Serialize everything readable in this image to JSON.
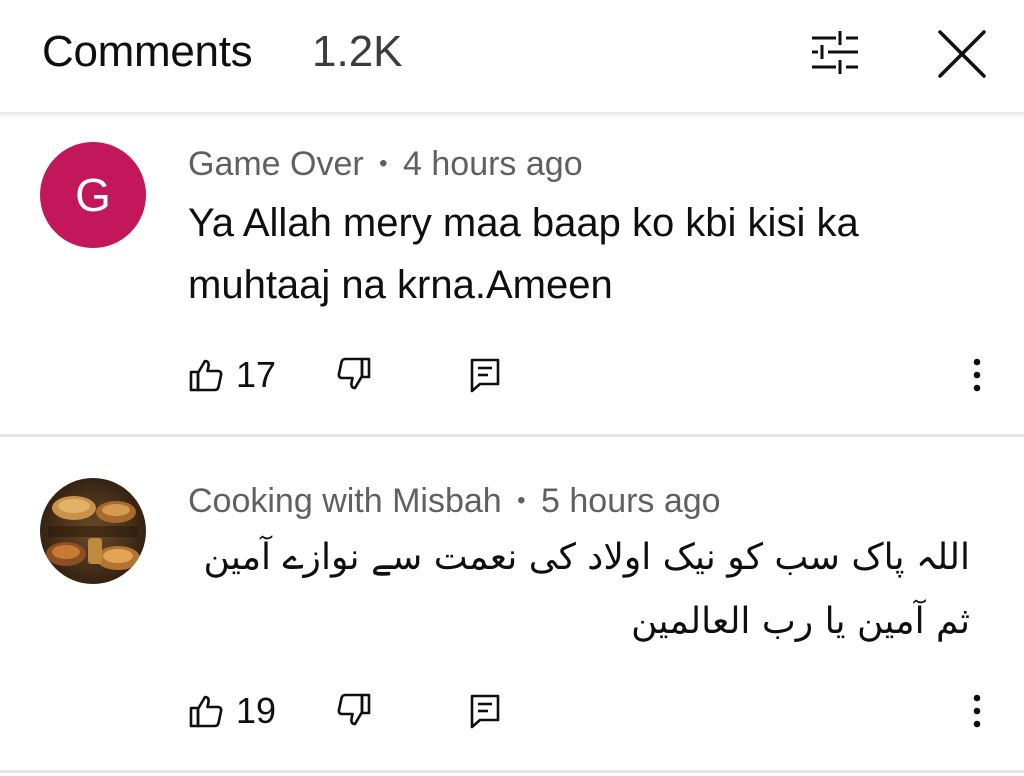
{
  "header": {
    "title": "Comments",
    "count": "1.2K",
    "filter_icon": "sliders-icon",
    "close_icon": "close-icon"
  },
  "comments": [
    {
      "avatar_letter": "G",
      "avatar_color": "#c2185b",
      "author": "Game Over",
      "separator": "•",
      "time": "4 hours ago",
      "text": "Ya Allah mery maa baap ko kbi kisi ka muhtaaj na krna.Ameen",
      "likes": "17"
    },
    {
      "avatar_image_text": "Cooking With Misbah",
      "author": "Cooking with Misbah",
      "separator": "•",
      "time": "5 hours ago",
      "text": "اللہ پاک سب کو نیک اولاد کی نعمت سے نوازے آمین ثم آمین یا رب العالمین",
      "likes": "19"
    }
  ],
  "colors": {
    "text_primary": "#0f0f0f",
    "text_secondary": "#606060",
    "divider": "#e5e5e5"
  }
}
